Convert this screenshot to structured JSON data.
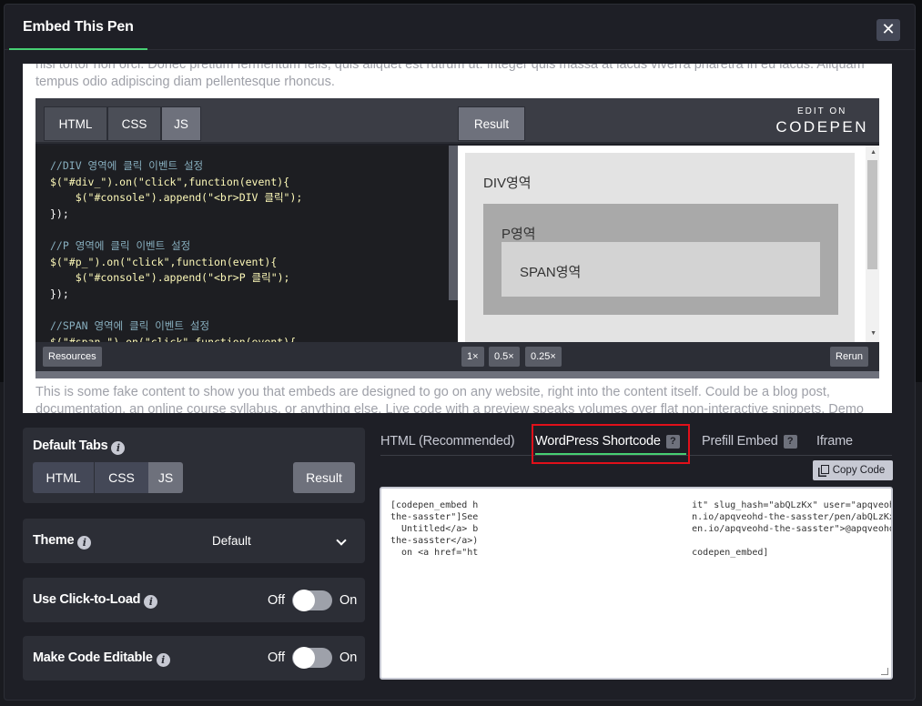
{
  "modal": {
    "title": "Embed This Pen",
    "close_label": "✕"
  },
  "preview": {
    "fake_top": "nisi tortor non orci. Donec pretium fermentum felis, quis aliquet est rutrum ut. Integer quis massa at lacus viverra pharetra in eu lacus. Aliquam tempus odio adipiscing diam pellentesque rhoncus.",
    "fake_bottom": "This is some fake content to show you that embeds are designed to go on any website, right into the content itself. Could be a blog post, documentation, an online course syllabus, or anything else. Live code with a preview speaks volumes over flat non-interactive snippets. Demo"
  },
  "pen": {
    "tabs": [
      "HTML",
      "CSS",
      "JS"
    ],
    "result_tab": "Result",
    "edit_on": "EDIT ON",
    "logo": "CODEPEN",
    "code_lines": [
      "//DIV 영역에 클릭 이벤트 설정",
      "$(\"#div_\").on(\"click\",function(event){",
      "    $(\"#console\").append(\"<br>DIV 클릭\");",
      "});",
      "",
      "//P 영역에 클릭 이벤트 설정",
      "$(\"#p_\").on(\"click\",function(event){",
      "    $(\"#console\").append(\"<br>P 클릭\");",
      "});",
      "",
      "//SPAN 영역에 클릭 이벤트 설정",
      "$(\"#span_\").on(\"click\",function(event){"
    ],
    "result": {
      "div_label": "DIV영역",
      "p_label": "P영역",
      "span_label": "SPAN영역"
    },
    "footer": {
      "resources": "Resources",
      "zoom_1x": "1×",
      "zoom_05x": "0.5×",
      "zoom_025x": "0.25×",
      "rerun": "Rerun"
    }
  },
  "settings": {
    "default_tabs": {
      "title": "Default Tabs",
      "tabs": [
        "HTML",
        "CSS",
        "JS"
      ],
      "result": "Result"
    },
    "theme": {
      "title": "Theme",
      "value": "Default"
    },
    "click_to_load": {
      "title": "Use Click-to-Load",
      "off": "Off",
      "on": "On"
    },
    "editable": {
      "title": "Make Code Editable",
      "off": "Off",
      "on": "On"
    }
  },
  "embed_tabs": {
    "html": "HTML (Recommended)",
    "wordpress": "WordPress Shortcode",
    "prefill": "Prefill Embed",
    "iframe": "Iframe",
    "help": "?"
  },
  "copy_code": "Copy Code",
  "code_box": {
    "lines": [
      "[codepen_embed h                                       it\" slug_hash=\"abQLzKx\" user=\"apqveohd-",
      "the-sasster\"]See                                       n.io/apqveohd-the-sasster/pen/abQLzKx\">",
      "  Untitled</a> b                                       en.io/apqveohd-the-sasster\">@apqveohd-",
      "the-sasster</a>)",
      "  on <a href=\"ht                                       codepen_embed]"
    ]
  }
}
